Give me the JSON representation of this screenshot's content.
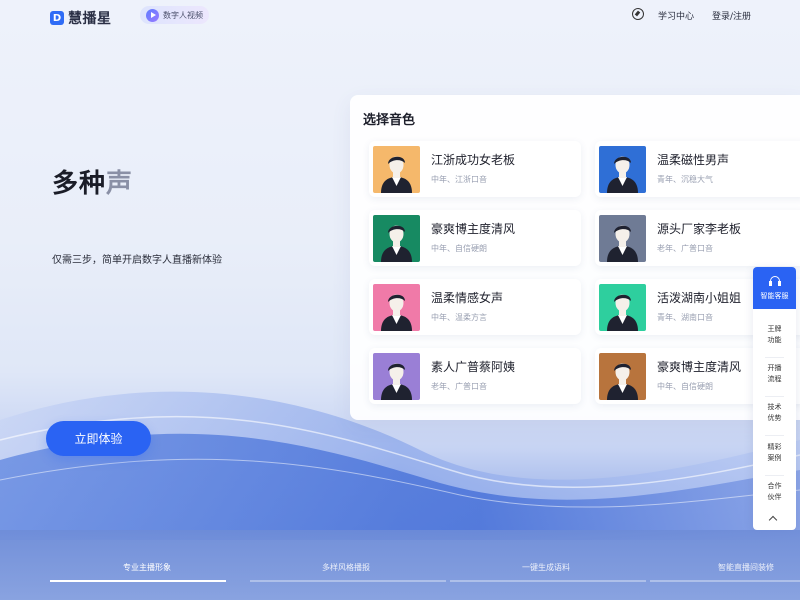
{
  "header": {
    "logo_mark": "D",
    "logo_text": "慧播星",
    "sub_product": "数字人视频",
    "nav": {
      "learn": "学习中心",
      "login": "登录/注册"
    }
  },
  "hero": {
    "title_dark": "多种",
    "title_light": "声",
    "subtitle": "仅需三步，简单开启数字人直播新体验",
    "cta": "立即体验"
  },
  "voice_panel": {
    "title": "选择音色",
    "voices": [
      {
        "name": "江浙成功女老板",
        "desc": "中年、江浙口音",
        "bg": "#f5b86b",
        "avatar": "woman-bob-icon"
      },
      {
        "name": "温柔磁性男声",
        "desc": "青年、沉稳大气",
        "bg": "#2f6fd6",
        "avatar": "man-suit-icon"
      },
      {
        "name": "豪爽博主度清风",
        "desc": "中年、自信硬朗",
        "bg": "#178a62",
        "avatar": "man-tie-icon"
      },
      {
        "name": "源头厂家李老板",
        "desc": "老年、广普口音",
        "bg": "#6f7b95",
        "avatar": "old-man-icon"
      },
      {
        "name": "温柔情感女声",
        "desc": "中年、温柔方言",
        "bg": "#f07aa8",
        "avatar": "woman-long-hair-icon"
      },
      {
        "name": "活泼湖南小姐姐",
        "desc": "青年、湖南口音",
        "bg": "#2ecf9e",
        "avatar": "young-woman-icon"
      },
      {
        "name": "素人广普蔡阿姨",
        "desc": "老年、广普口音",
        "bg": "#9a7fd6",
        "avatar": "woman-glasses-icon"
      },
      {
        "name": "豪爽博主度清风",
        "desc": "中年、自信硬朗",
        "bg": "#b8743d",
        "avatar": "man-jacket-icon"
      }
    ]
  },
  "float_menu": {
    "service": "智能客服",
    "items": [
      "王牌功能",
      "开播流程",
      "技术优势",
      "精彩案例",
      "合作伙伴"
    ]
  },
  "tabs": [
    "专业主播形象",
    "多样风格播报",
    "一键生成语料",
    "智能直播间装修"
  ],
  "colors": {
    "primary": "#2a63f3",
    "text": "#1d1f2b",
    "muted": "#9aa0b2"
  }
}
